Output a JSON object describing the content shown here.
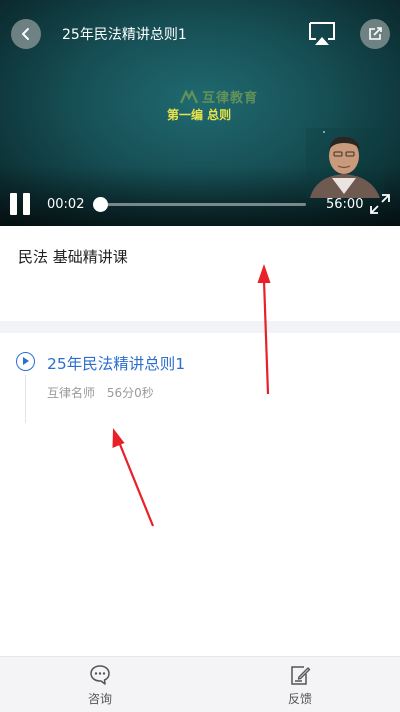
{
  "player": {
    "title": "25年民法精讲总则1",
    "logo_text": "互律教育",
    "slide_caption": "第一编 总则",
    "current_time": "00:02",
    "total_time": "56:00",
    "progress": 0.0006,
    "icons": {
      "back": "back-arrow-icon",
      "cast": "screen-cast-icon",
      "share": "share-icon",
      "pause": "pause-icon",
      "fullscreen": "fullscreen-icon"
    }
  },
  "course": {
    "title": "民法 基础精讲课"
  },
  "lessons": [
    {
      "title": "25年民法精讲总则1",
      "teacher": "互律名师",
      "duration": "56分0秒",
      "icon": "play-circle-icon"
    }
  ],
  "bottom_bar": {
    "consult_label": "咨询",
    "feedback_label": "反馈",
    "consult_icon": "chat-bubble-icon",
    "feedback_icon": "edit-note-icon"
  },
  "colors": {
    "accent": "#2c6fd0",
    "annotation": "#e8202a",
    "player_bg": "#164f55"
  }
}
